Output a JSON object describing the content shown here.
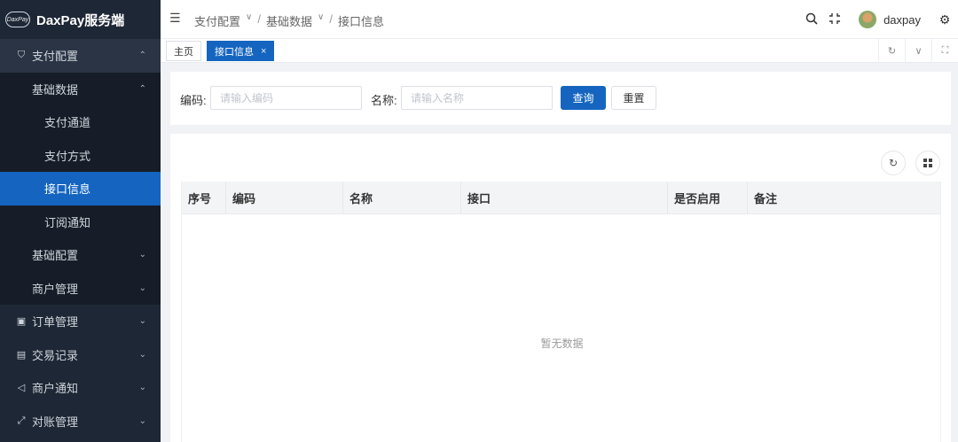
{
  "brand": {
    "logo_mark": "DaxPay",
    "title": "DaxPay服务端"
  },
  "sidebar": {
    "items": [
      {
        "label": "支付配置",
        "icon": "shield-icon",
        "arrow": "⌃"
      },
      {
        "label": "基础数据",
        "arrow": "⌃"
      },
      {
        "label": "支付通道"
      },
      {
        "label": "支付方式"
      },
      {
        "label": "接口信息"
      },
      {
        "label": "订阅通知"
      },
      {
        "label": "基础配置",
        "arrow": "⌄"
      },
      {
        "label": "商户管理",
        "arrow": "⌄"
      },
      {
        "label": "订单管理",
        "icon": "order-icon",
        "arrow": "⌄"
      },
      {
        "label": "交易记录",
        "icon": "record-icon",
        "arrow": "⌄"
      },
      {
        "label": "商户通知",
        "icon": "notify-icon",
        "arrow": "⌄"
      },
      {
        "label": "对账管理",
        "icon": "reconcile-icon",
        "arrow": "⌄"
      }
    ]
  },
  "header": {
    "breadcrumb": [
      "支付配置",
      "基础数据",
      "接口信息"
    ],
    "username": "daxpay"
  },
  "tabs": {
    "home": "主页",
    "current": "接口信息",
    "close": "×"
  },
  "search": {
    "code_label": "编码:",
    "code_placeholder": "请输入编码",
    "name_label": "名称:",
    "name_placeholder": "请输入名称",
    "query_button": "查询",
    "reset_button": "重置"
  },
  "table": {
    "columns": [
      "序号",
      "编码",
      "名称",
      "接口",
      "是否启用",
      "备注"
    ],
    "rows": [],
    "empty_text": "暂无数据"
  }
}
